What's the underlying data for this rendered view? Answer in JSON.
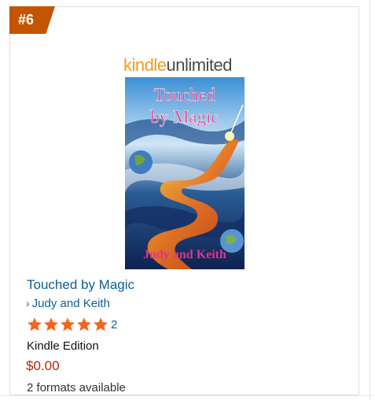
{
  "badge": {
    "rank": "#6"
  },
  "program_logo": {
    "part1": "kindle",
    "part2": "unlimited"
  },
  "cover": {
    "title_line1": "Touched",
    "title_line2": "by Magic",
    "author": "Judy and Keith"
  },
  "product": {
    "title": "Touched by Magic",
    "author": "Judy and Keith",
    "rating": {
      "stars": 5,
      "max": 5,
      "count": "2"
    },
    "format": "Kindle Edition",
    "price": "$0.00",
    "formats_available": "2 formats available"
  },
  "colors": {
    "badge": "#c45500",
    "link": "#0f5d92",
    "price": "#b12704",
    "star": "#f2661b",
    "kindle_orange": "#f29a1f"
  }
}
